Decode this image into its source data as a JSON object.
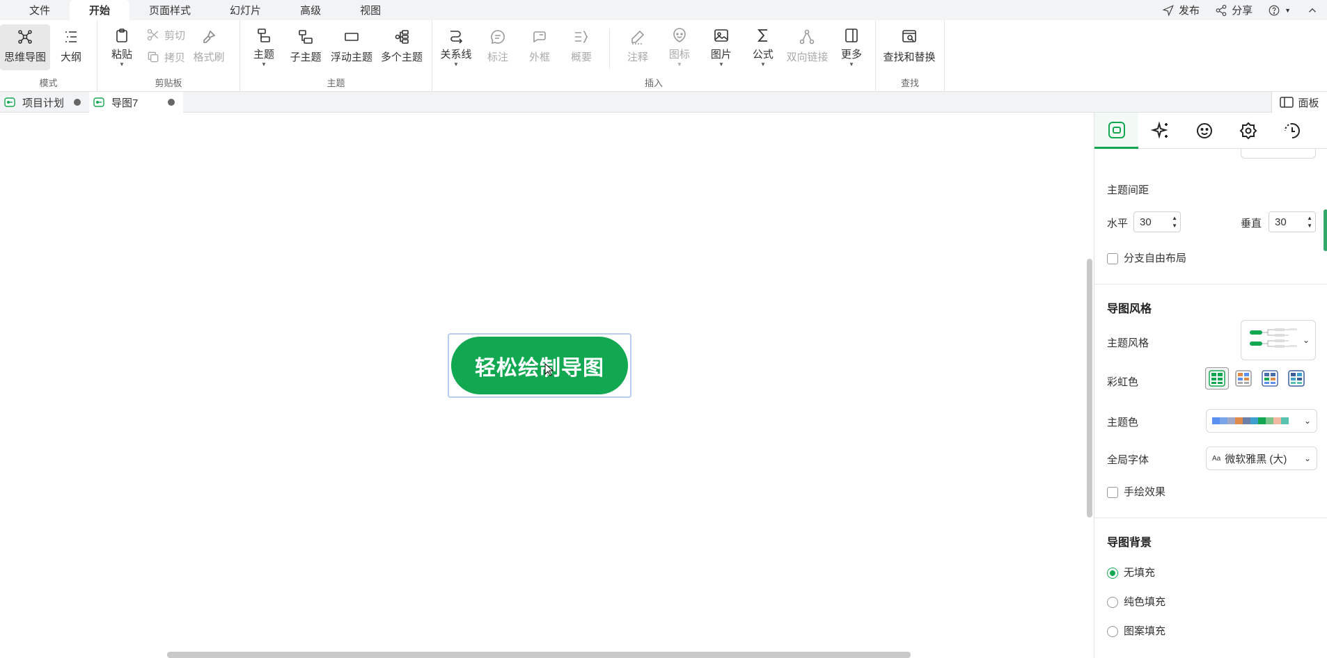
{
  "menu": {
    "tabs": [
      {
        "label": "文件"
      },
      {
        "label": "开始"
      },
      {
        "label": "页面样式"
      },
      {
        "label": "幻灯片"
      },
      {
        "label": "高级"
      },
      {
        "label": "视图"
      }
    ],
    "publish": "发布",
    "share": "分享"
  },
  "ribbon": {
    "mode": {
      "label": "模式",
      "mindmap": "思维导图",
      "outline": "大纲"
    },
    "clipboard": {
      "label": "剪贴板",
      "paste": "粘贴",
      "cut": "剪切",
      "copy": "拷贝",
      "format_painter": "格式刷"
    },
    "topic": {
      "label": "主题",
      "topic": "主题",
      "subtopic": "子主题",
      "floating": "浮动主题",
      "multi": "多个主题"
    },
    "insert": {
      "label": "插入",
      "relation": "关系线",
      "callout": "标注",
      "boundary": "外框",
      "summary": "概要",
      "note": "注释",
      "icon": "图标",
      "image": "图片",
      "formula": "公式",
      "bilink": "双向链接",
      "more": "更多"
    },
    "find": {
      "label": "查找",
      "find_replace": "查找和替换"
    }
  },
  "doc_tabs": [
    {
      "label": "项目计划"
    },
    {
      "label": "导图7"
    }
  ],
  "panel_toggle": "面板",
  "canvas": {
    "central_topic": "轻松绘制导图"
  },
  "panel": {
    "topic_spacing": "主题间距",
    "horizontal": "水平",
    "horizontal_value": "30",
    "vertical": "垂直",
    "vertical_value": "30",
    "free_layout": "分支自由布局",
    "map_style_heading": "导图风格",
    "topic_style": "主题风格",
    "rainbow": "彩虹色",
    "theme_color": "主题色",
    "global_font": "全局字体",
    "font_value": "微软雅黑 (大)",
    "font_prefix": "Aa",
    "hand_drawn": "手绘效果",
    "background_heading": "导图背景",
    "bg_none": "无填充",
    "bg_solid": "纯色填充",
    "bg_pattern": "图案填充",
    "theme_colors": [
      "#5b8ff0",
      "#7aa6e8",
      "#a0a8c8",
      "#e08a4a",
      "#6c7fa8",
      "#3fa0d0",
      "#12a852",
      "#7cc48a",
      "#f0b8a0",
      "#58c4b0"
    ]
  },
  "colors": {
    "accent": "#12a852",
    "menu_bg": "#f2f3f5"
  }
}
